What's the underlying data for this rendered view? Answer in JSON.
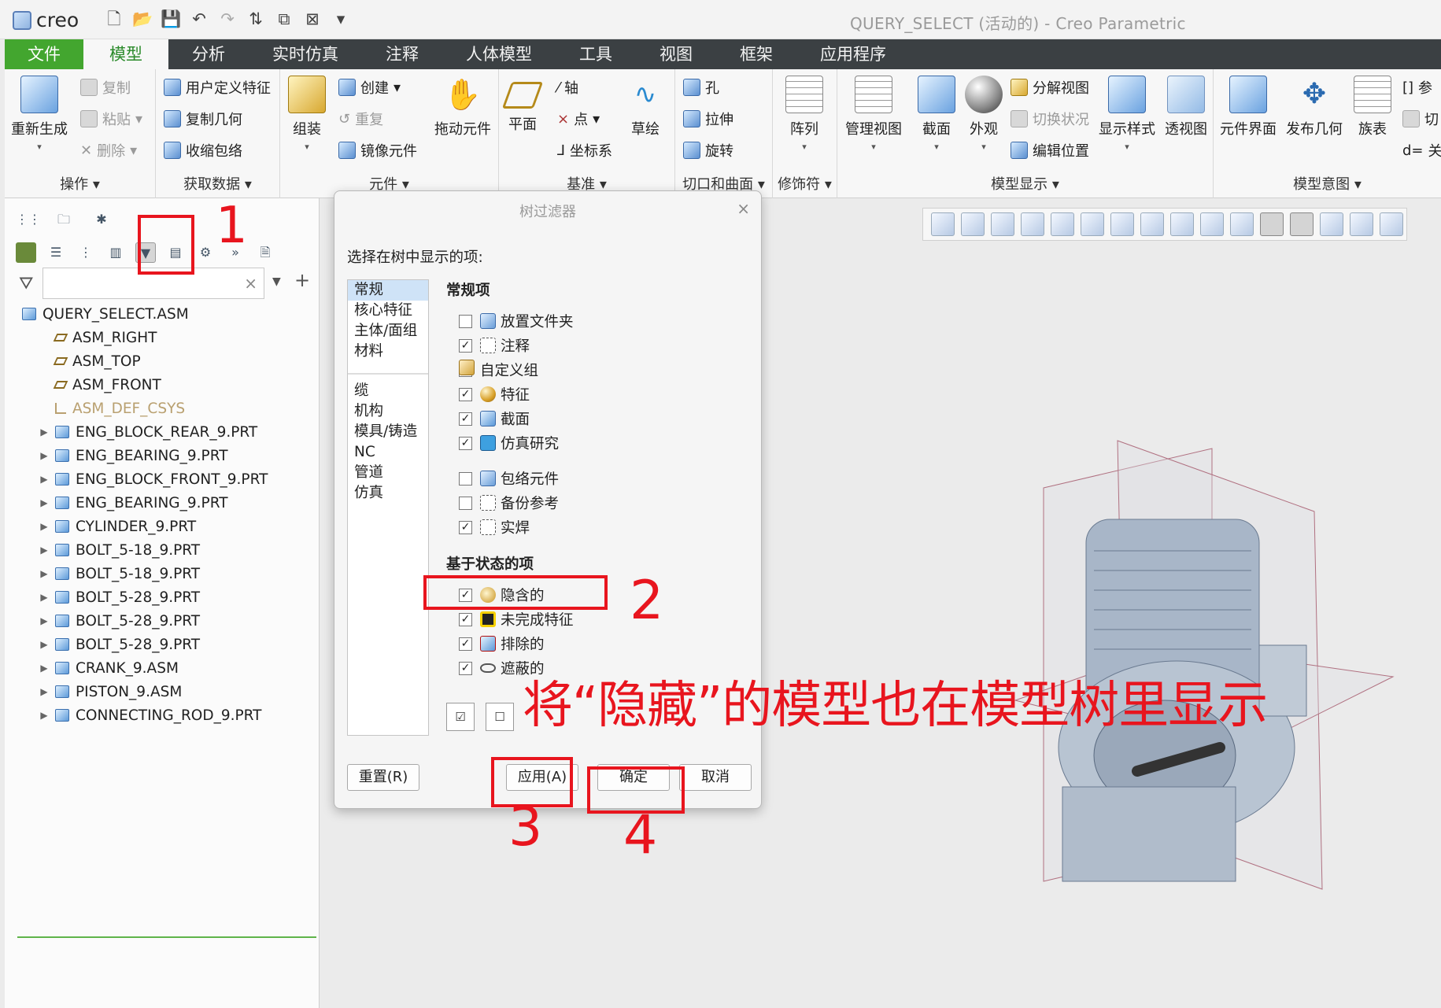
{
  "app": {
    "logo": "creo",
    "window_title": "QUERY_SELECT (活动的) - Creo Parametric"
  },
  "quick_access": [
    "new-icon",
    "open-icon",
    "save-icon",
    "undo-icon",
    "redo-icon",
    "regenerate-icon",
    "windows-icon",
    "close-icon",
    "customize-icon"
  ],
  "tabs": [
    "文件",
    "模型",
    "分析",
    "实时仿真",
    "注释",
    "人体模型",
    "工具",
    "视图",
    "框架",
    "应用程序"
  ],
  "ribbon": {
    "operations": {
      "label": "操作 ▾",
      "regen": "重新生成",
      "copy": "复制",
      "paste": "粘贴",
      "delete": "删除"
    },
    "get_data": {
      "label": "获取数据 ▾",
      "udf": "用户定义特征",
      "copy_geom": "复制几何",
      "shrinkwrap": "收缩包络"
    },
    "component": {
      "label": "元件 ▾",
      "assemble": "组装",
      "create": "创建",
      "repeat": "重复",
      "mirror": "镜像元件",
      "drag": "拖动元件"
    },
    "datum": {
      "label": "基准 ▾",
      "plane": "平面",
      "axis": "轴",
      "point": "点",
      "csys": "坐标系",
      "sketch": "草绘"
    },
    "cut_surface": {
      "label": "切口和曲面 ▾",
      "hole": "孔",
      "extrude": "拉伸",
      "revolve": "旋转"
    },
    "modifiers": {
      "label": "修饰符 ▾",
      "pattern": "阵列"
    },
    "model_display": {
      "label": "模型显示 ▾",
      "manage_views": "管理视图",
      "section": "截面",
      "appearance": "外观",
      "explode": "分解视图",
      "toggle": "切换状况",
      "edit_pos": "编辑位置",
      "display_style": "显示样式",
      "perspective": "透视图"
    },
    "model_intent": {
      "label": "模型意图 ▾",
      "comp_interface": "元件界面",
      "publish_geom": "发布几何",
      "family_table": "族表",
      "param": "参",
      "switch": "切",
      "rel": "关"
    }
  },
  "tree": {
    "search_placeholder": "",
    "items": [
      {
        "label": "QUERY_SELECT.ASM",
        "type": "asm",
        "exp": ""
      },
      {
        "label": "ASM_RIGHT",
        "type": "plane",
        "exp": ""
      },
      {
        "label": "ASM_TOP",
        "type": "plane",
        "exp": ""
      },
      {
        "label": "ASM_FRONT",
        "type": "plane",
        "exp": ""
      },
      {
        "label": "ASM_DEF_CSYS",
        "type": "csys",
        "exp": ""
      },
      {
        "label": "ENG_BLOCK_REAR_9.PRT",
        "type": "part",
        "exp": "▶"
      },
      {
        "label": "ENG_BEARING_9.PRT",
        "type": "part",
        "exp": "▶"
      },
      {
        "label": "ENG_BLOCK_FRONT_9.PRT",
        "type": "part",
        "exp": "▶"
      },
      {
        "label": "ENG_BEARING_9.PRT",
        "type": "part",
        "exp": "▶"
      },
      {
        "label": "CYLINDER_9.PRT",
        "type": "part",
        "exp": "▶"
      },
      {
        "label": "BOLT_5-18_9.PRT",
        "type": "part",
        "exp": "▶"
      },
      {
        "label": "BOLT_5-18_9.PRT",
        "type": "part",
        "exp": "▶"
      },
      {
        "label": "BOLT_5-28_9.PRT",
        "type": "part",
        "exp": "▶"
      },
      {
        "label": "BOLT_5-28_9.PRT",
        "type": "part",
        "exp": "▶"
      },
      {
        "label": "BOLT_5-28_9.PRT",
        "type": "part",
        "exp": "▶"
      },
      {
        "label": "CRANK_9.ASM",
        "type": "asm",
        "exp": "▶"
      },
      {
        "label": "PISTON_9.ASM",
        "type": "asm",
        "exp": "▶"
      },
      {
        "label": "CONNECTING_ROD_9.PRT",
        "type": "part",
        "exp": "▶"
      }
    ]
  },
  "dialog": {
    "title": "树过滤器",
    "prompt": "选择在树中显示的项:",
    "categories_top": [
      "常规",
      "核心特征",
      "主体/面组",
      "材料"
    ],
    "categories_bottom": [
      "缆",
      "机构",
      "模具/铸造",
      "NC",
      "管道",
      "仿真"
    ],
    "general_header": "常规项",
    "general_items": [
      {
        "label": "放置文件夹",
        "checked": false,
        "icon": "folder-icon"
      },
      {
        "label": "注释",
        "checked": true,
        "icon": "annotation-icon"
      },
      {
        "label": "自定义组",
        "checked": true,
        "icon": "group-icon"
      },
      {
        "label": "特征",
        "checked": true,
        "icon": "feature-icon"
      },
      {
        "label": "截面",
        "checked": true,
        "icon": "section-icon"
      },
      {
        "label": "仿真研究",
        "checked": true,
        "icon": "simulation-icon"
      },
      {
        "label": "包络元件",
        "checked": false,
        "icon": "envelope-icon"
      },
      {
        "label": "备份参考",
        "checked": false,
        "icon": "backup-icon"
      },
      {
        "label": "实焊",
        "checked": true,
        "icon": "weld-icon"
      }
    ],
    "state_header": "基于状态的项",
    "state_items": [
      {
        "label": "隐含的",
        "checked": true,
        "icon": "suppressed-icon"
      },
      {
        "label": "未完成特征",
        "checked": true,
        "icon": "incomplete-icon"
      },
      {
        "label": "排除的",
        "checked": true,
        "icon": "excluded-icon"
      },
      {
        "label": "遮蔽的",
        "checked": true,
        "icon": "hidden-eye-icon"
      }
    ],
    "buttons": {
      "reset": "重置(R)",
      "apply": "应用(A)",
      "ok": "确定",
      "cancel": "取消"
    }
  },
  "annotations": {
    "n1": "1",
    "n2": "2",
    "n3": "3",
    "n4": "4",
    "caption": "将“隐藏”的模型也在模型树里显示"
  },
  "colors": {
    "annotation": "#e8151e",
    "file_tab": "#43a62f",
    "tabbar": "#3b4043"
  }
}
